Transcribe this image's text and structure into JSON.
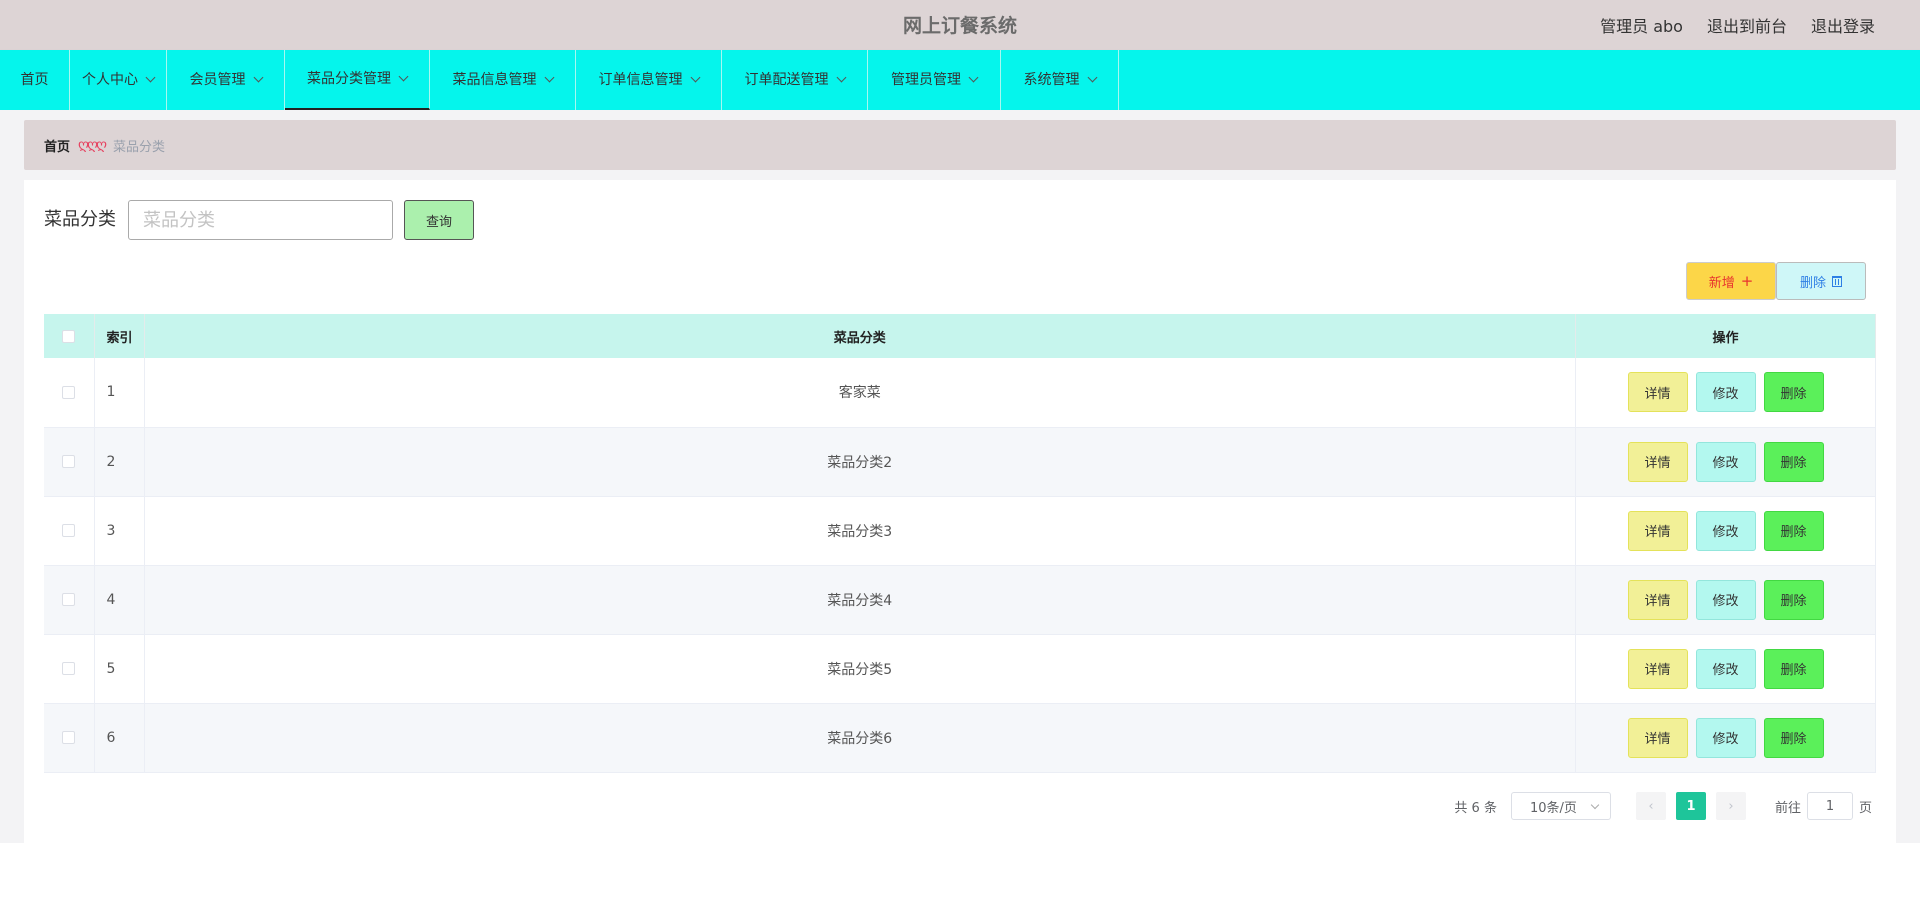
{
  "header": {
    "title": "网上订餐系统",
    "user_label": "管理员 abo",
    "to_front_label": "退出到前台",
    "logout_label": "退出登录"
  },
  "nav": {
    "items": [
      {
        "label": "首页",
        "has_dropdown": false
      },
      {
        "label": "个人中心",
        "has_dropdown": true
      },
      {
        "label": "会员管理",
        "has_dropdown": true
      },
      {
        "label": "菜品分类管理",
        "has_dropdown": true,
        "active": true
      },
      {
        "label": "菜品信息管理",
        "has_dropdown": true
      },
      {
        "label": "订单信息管理",
        "has_dropdown": true
      },
      {
        "label": "订单配送管理",
        "has_dropdown": true
      },
      {
        "label": "管理员管理",
        "has_dropdown": true
      },
      {
        "label": "系统管理",
        "has_dropdown": true
      }
    ]
  },
  "breadcrumb": {
    "home": "首页",
    "separator": "ღღღ",
    "current": "菜品分类"
  },
  "search": {
    "label": "菜品分类",
    "placeholder": "菜品分类",
    "value": "",
    "button": "查询"
  },
  "actions": {
    "add_label": "新增",
    "add_icon": "plus-icon",
    "delete_label": "删除",
    "delete_icon": "trash-icon"
  },
  "table": {
    "columns": [
      "索引",
      "菜品分类",
      "操作"
    ],
    "rows": [
      {
        "index": "1",
        "name": "客家菜"
      },
      {
        "index": "2",
        "name": "菜品分类2"
      },
      {
        "index": "3",
        "name": "菜品分类3"
      },
      {
        "index": "4",
        "name": "菜品分类4"
      },
      {
        "index": "5",
        "name": "菜品分类5"
      },
      {
        "index": "6",
        "name": "菜品分类6"
      }
    ],
    "row_actions": {
      "detail": "详情",
      "edit": "修改",
      "delete": "删除"
    }
  },
  "pagination": {
    "total": "共 6 条",
    "page_size": "10条/页",
    "current_page": "1",
    "goto_prefix": "前往",
    "goto_value": "1",
    "goto_suffix": "页"
  },
  "colors": {
    "navbar": "#05f5ec",
    "header": "#ddd4d5",
    "active_page": "#1ec59a",
    "link": "#2e7fe5"
  }
}
